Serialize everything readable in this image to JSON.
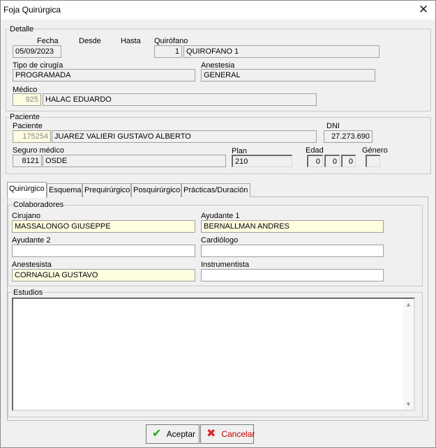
{
  "window": {
    "title": "Foja Quirúrgica",
    "close_glyph": "✕"
  },
  "detalle": {
    "group_label": "Detalle",
    "fecha_label": "Fecha",
    "fecha": "05/09/2023",
    "desde_label": "Desde",
    "hasta_label": "Hasta",
    "quirofano_label": "Quirófano",
    "quirofano_num": "1",
    "quirofano_name": "QUIROFANO 1",
    "tipo_label": "Tipo de cirugía",
    "tipo": "PROGRAMADA",
    "anestesia_label": "Anestesia",
    "anestesia": "GENERAL",
    "medico_label": "Médico",
    "medico_id": "925",
    "medico_name": "HALAC EDUARDO"
  },
  "paciente": {
    "group_label": "Paciente",
    "paciente_label": "Paciente",
    "paciente_id": "175254",
    "paciente_name": "JUAREZ VALIERI GUSTAVO ALBERTO",
    "dni_label": "DNI",
    "dni": "27.273.690",
    "seguro_label": "Seguro médico",
    "seguro_id": "8121",
    "seguro_name": "OSDE",
    "plan_label": "Plan",
    "plan": "210",
    "edad_label": "Edad",
    "edad_1": "0",
    "edad_2": "0",
    "edad_3": "0",
    "genero_label": "Género",
    "genero": ""
  },
  "tabs": [
    "Quirúrgico",
    "Esquema",
    "Prequirúrgico",
    "Posquirúrgico",
    "Prácticas/Duración"
  ],
  "colaboradores": {
    "group_label": "Colaboradores",
    "cirujano_label": "Cirujano",
    "cirujano": "MASSALONGO GIUSEPPE",
    "ayudante1_label": "Ayudante 1",
    "ayudante1": "BERNALLMAN ANDRES",
    "ayudante2_label": "Ayudante 2",
    "ayudante2": "",
    "cardiologo_label": "Cardiólogo",
    "cardiologo": "",
    "anestesista_label": "Anestesista",
    "anestesista": "CORNAGLIA GUSTAVO",
    "instrumentista_label": "Instrumentista",
    "instrumentista": ""
  },
  "estudios": {
    "group_label": "Estudios",
    "text": ""
  },
  "buttons": {
    "aceptar": "Aceptar",
    "cancelar": "Cancelar"
  },
  "icons": {
    "ok": "check-icon",
    "cancel": "x-icon"
  },
  "colors": {
    "highlight_field": "#fffde0",
    "cancel_text": "#c00000",
    "ok_icon": "#2f9e23"
  }
}
